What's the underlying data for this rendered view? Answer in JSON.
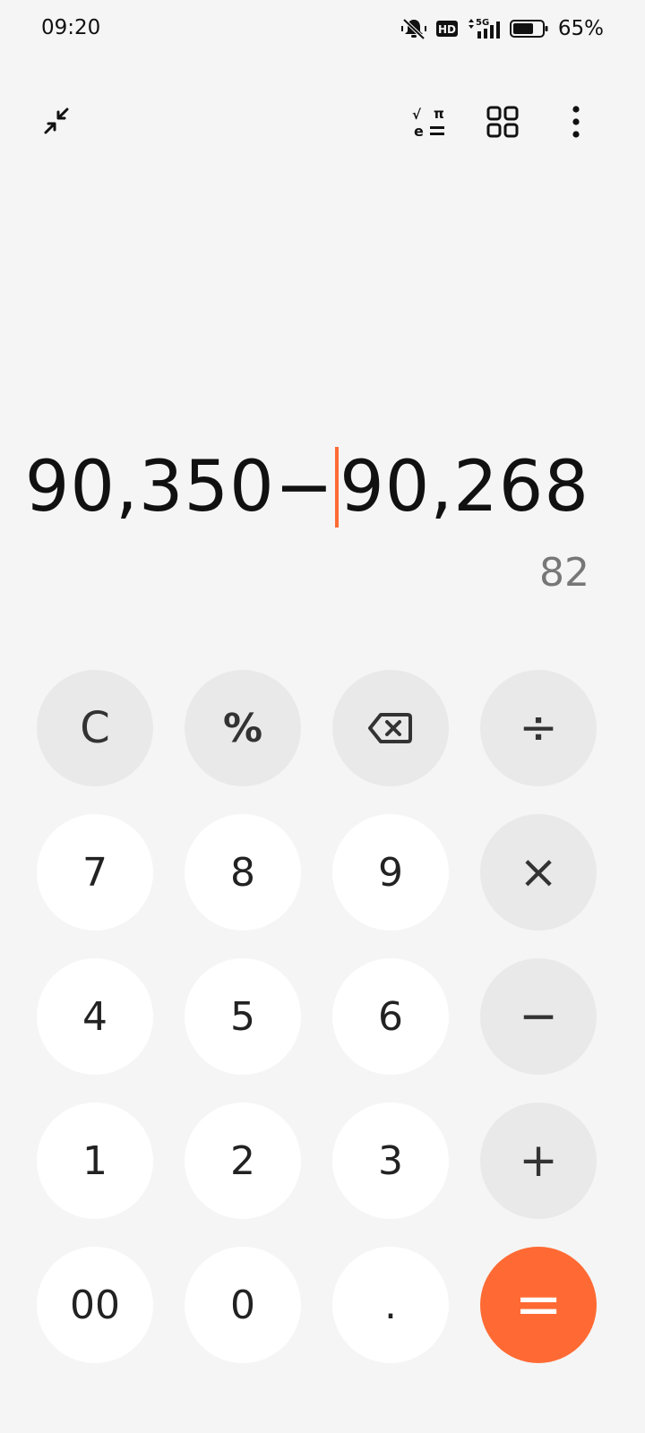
{
  "status_bar": {
    "time": "09:20",
    "icons": [
      "mute-bell-icon",
      "hd-icon",
      "5g-signal-icon",
      "battery-icon"
    ],
    "network": "5G",
    "hd": "HD",
    "battery": "65%"
  },
  "toolbar": {
    "collapse_icon": "collapse-icon",
    "scientific_icon": "scientific-functions-icon",
    "scientific_symbols": [
      "√",
      "π",
      "e",
      "="
    ],
    "converter_icon": "grid-icon",
    "menu_icon": "more-vertical-icon"
  },
  "display": {
    "expression_before_cursor": "90,350−",
    "expression_after_cursor": "90,268",
    "result": "82"
  },
  "keypad": {
    "clear": "C",
    "percent": "%",
    "backspace_icon": "backspace-icon",
    "divide": "÷",
    "k7": "7",
    "k8": "8",
    "k9": "9",
    "multiply": "×",
    "k4": "4",
    "k5": "5",
    "k6": "6",
    "minus": "−",
    "k1": "1",
    "k2": "2",
    "k3": "3",
    "plus": "+",
    "k00": "00",
    "k0": "0",
    "dot": ".",
    "equals": "="
  },
  "colors": {
    "accent": "#ff6a34",
    "background": "#f5f5f5",
    "number_key": "#ffffff",
    "function_key": "#e9e9ea",
    "result_text": "#777777"
  }
}
